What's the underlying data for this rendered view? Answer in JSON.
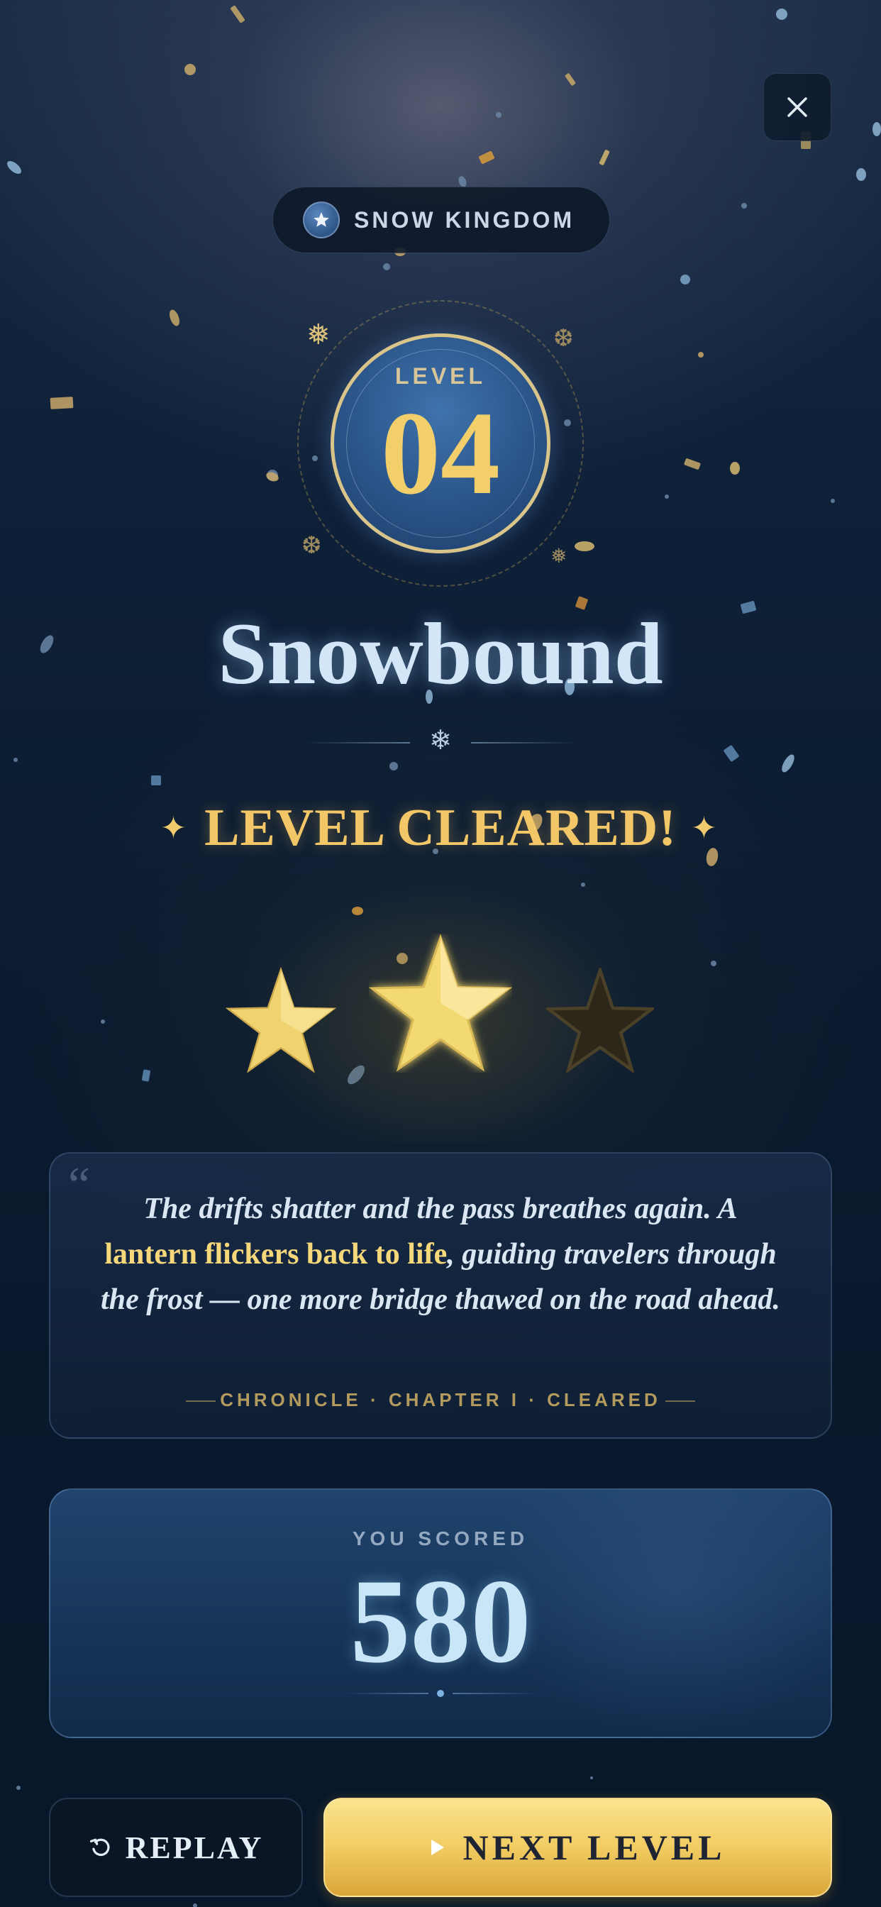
{
  "header": {
    "world_name": "SNOW KINGDOM",
    "close_icon": "close-icon",
    "world_icon": "star-icon"
  },
  "level": {
    "label": "LEVEL",
    "number": "04",
    "name": "Snowbound"
  },
  "result": {
    "headline": "LEVEL CLEARED!",
    "stars_earned": 2,
    "stars_total": 3
  },
  "story": {
    "text_before": "The drifts shatter and the pass breathes again. A ",
    "highlight": "lantern flickers back to life",
    "text_after": ", guiding travelers through the frost — one more bridge thawed on the road ahead.",
    "footer": "CHRONICLE · CHAPTER I · CLEARED"
  },
  "score": {
    "label": "YOU SCORED",
    "value": "580"
  },
  "actions": {
    "replay_label": "REPLAY",
    "replay_icon": "replay-icon",
    "next_label": "NEXT LEVEL",
    "next_icon": "play-icon"
  },
  "colors": {
    "gold": "#f3c768",
    "star_filled": "#f5db78",
    "star_empty": "#2f2a1e",
    "ice": "#d2e6f7"
  }
}
